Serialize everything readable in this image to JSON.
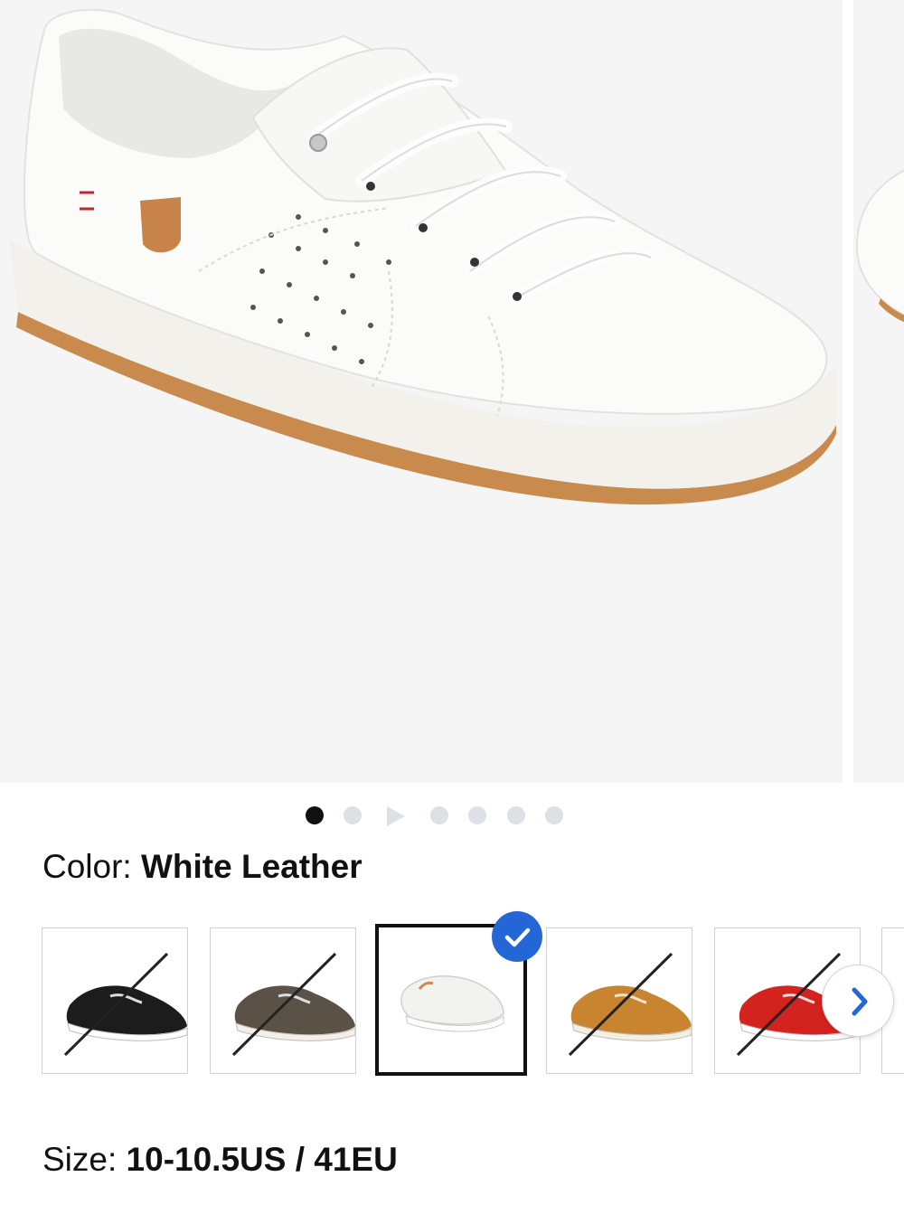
{
  "gallery": {
    "images": [
      {
        "alt": "product-photo-main"
      },
      {
        "alt": "product-photo-next"
      }
    ],
    "page_indicators": [
      "image",
      "image",
      "video",
      "image",
      "image",
      "image",
      "image"
    ],
    "active_index": 0
  },
  "color": {
    "label": "Color:",
    "selected": "White Leather",
    "swatches": [
      {
        "shoe": "#1c1c1c",
        "sole": "#ffffff",
        "unavailable": true
      },
      {
        "shoe": "#5a5247",
        "sole": "#f4f0e8",
        "unavailable": true
      },
      {
        "shoe": "#f2f2f0",
        "sole": "#ffffff",
        "unavailable": false,
        "selected": true
      },
      {
        "shoe": "#c98430",
        "sole": "#f5efe2",
        "unavailable": true
      },
      {
        "shoe": "#d4231f",
        "sole": "#ffffff",
        "unavailable": true
      }
    ]
  },
  "size": {
    "label": "Size:",
    "selected": "10-10.5US / 41EU"
  },
  "colors": {
    "accent": "#2566d6",
    "dot_inactive": "#dde0e5",
    "dot_active": "#111111",
    "selected_border": "#111111"
  }
}
